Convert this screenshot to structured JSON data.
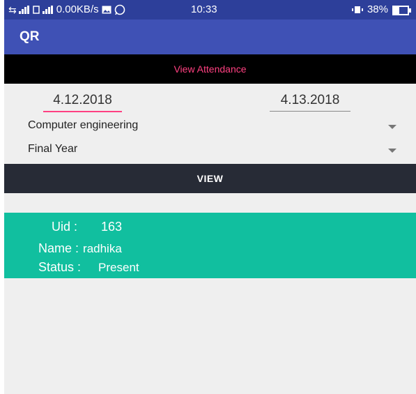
{
  "status_bar": {
    "network_speed": "0.00KB/s",
    "time": "10:33",
    "battery_percent": "38%",
    "battery_level": 0.38
  },
  "app_bar": {
    "title": "QR"
  },
  "subheader": {
    "title": "View Attendance"
  },
  "dates": {
    "from": "4.12.2018",
    "to": "4.13.2018"
  },
  "department": {
    "selected": "Computer engineering"
  },
  "year": {
    "selected": "Final Year"
  },
  "view_button": {
    "label": "VIEW"
  },
  "record": {
    "uid_label": "Uid :",
    "uid_value": "163",
    "name_label": "Name :",
    "name_value": "radhika",
    "status_label": "Status :",
    "status_value": "Present"
  },
  "colors": {
    "status_bar": "#2d3f9a",
    "app_bar": "#3f51b5",
    "accent": "#ff4081",
    "button": "#272b36",
    "card": "#11bf9f"
  }
}
